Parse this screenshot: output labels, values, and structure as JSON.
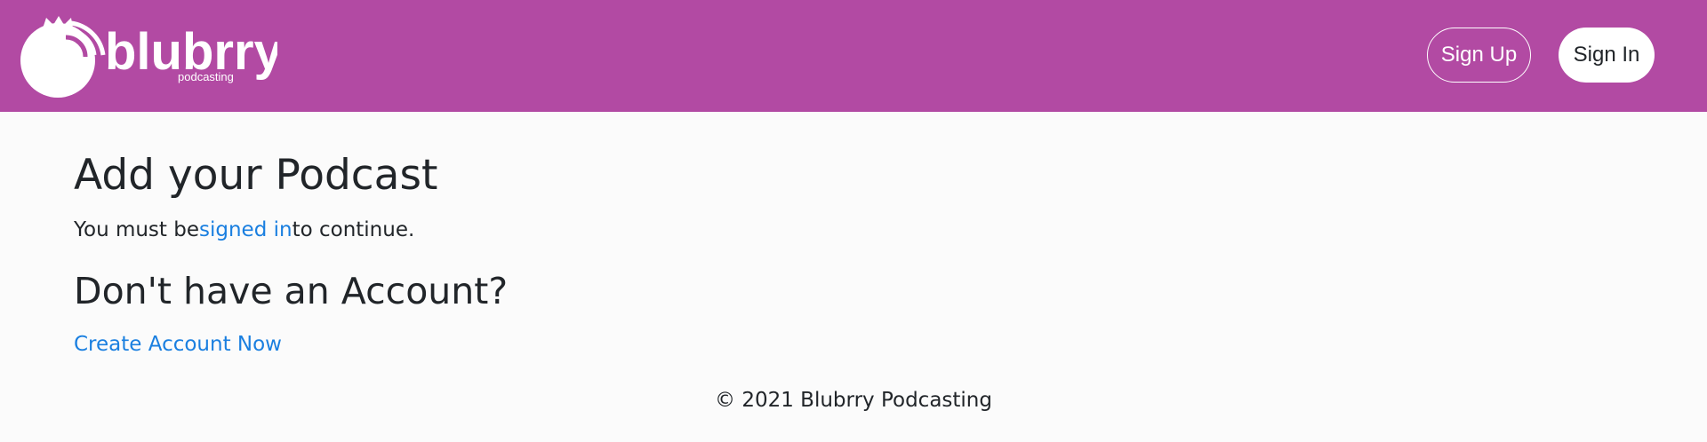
{
  "brand": {
    "name": "blubrry",
    "tagline": "podcasting"
  },
  "nav": {
    "signup_label": "Sign Up",
    "signin_label": "Sign In"
  },
  "main": {
    "title": "Add your Podcast",
    "notice_prefix": "You must be",
    "notice_link": "signed in",
    "notice_suffix": "to continue.",
    "subtitle": "Don't have an Account?",
    "create_link": "Create Account Now"
  },
  "footer": {
    "copyright": "© 2021 Blubrry Podcasting"
  },
  "colors": {
    "header_bg": "#b24aa3",
    "link": "#1a7fe0",
    "text": "#212529",
    "page_bg": "#fbfbfb"
  }
}
